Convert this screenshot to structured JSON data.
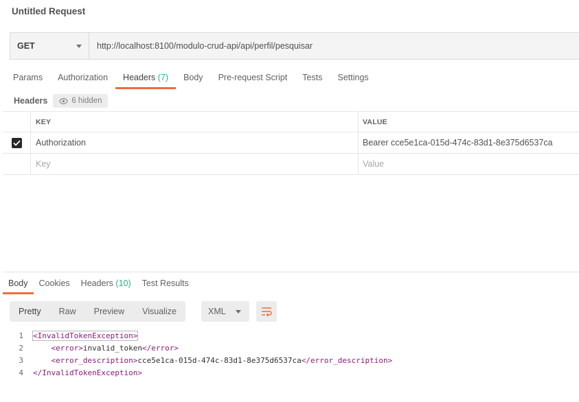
{
  "request": {
    "title": "Untitled Request",
    "method": "GET",
    "url": "http://localhost:8100/modulo-crud-api/api/perfil/pesquisar"
  },
  "request_tabs": {
    "params": "Params",
    "authorization": "Authorization",
    "headers_label": "Headers",
    "headers_count": "(7)",
    "body": "Body",
    "pre_request": "Pre-request Script",
    "tests": "Tests",
    "settings": "Settings"
  },
  "headers_section": {
    "label": "Headers",
    "hidden": "6 hidden",
    "columns": {
      "key": "KEY",
      "value": "VALUE"
    },
    "rows": [
      {
        "checked": true,
        "key": "Authorization",
        "value": "Bearer cce5e1ca-015d-474c-83d1-8e375d6537ca"
      }
    ],
    "placeholder_key": "Key",
    "placeholder_value": "Value"
  },
  "response_tabs": {
    "body": "Body",
    "cookies": "Cookies",
    "headers_label": "Headers",
    "headers_count": "(10)",
    "test_results": "Test Results"
  },
  "format_bar": {
    "pretty": "Pretty",
    "raw": "Raw",
    "preview": "Preview",
    "visualize": "Visualize",
    "language": "XML"
  },
  "response_body": {
    "lines": [
      {
        "n": "1",
        "indent": "",
        "open": "<InvalidTokenException>",
        "text": "",
        "close": ""
      },
      {
        "n": "2",
        "indent": "    ",
        "open": "<error>",
        "text": "invalid_token",
        "close": "</error>"
      },
      {
        "n": "3",
        "indent": "    ",
        "open": "<error_description>",
        "text": "cce5e1ca-015d-474c-83d1-8e375d6537ca",
        "close": "</error_description>"
      },
      {
        "n": "4",
        "indent": "",
        "open": "</InvalidTokenException>",
        "text": "",
        "close": ""
      }
    ]
  },
  "colors": {
    "accent": "#f26b3a",
    "count": "#26b47f",
    "xml_tag": "#8a1a7a"
  }
}
